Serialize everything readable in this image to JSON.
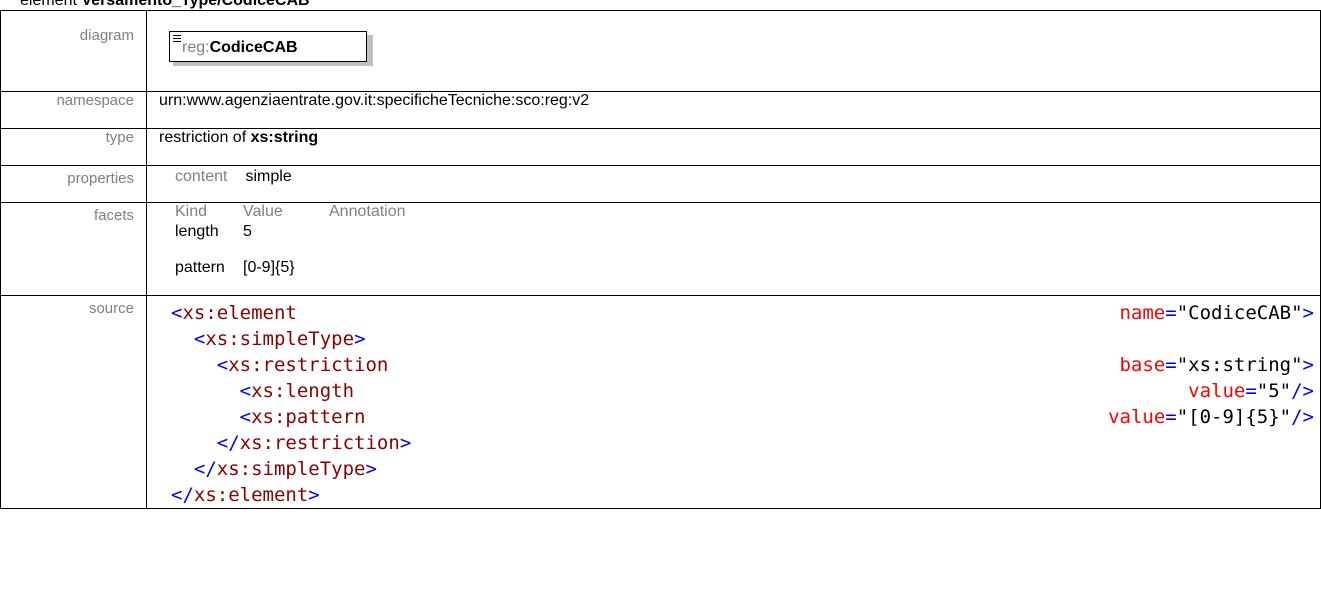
{
  "heading": {
    "prefix": "element ",
    "title": "Versamento_Type/CodiceCAB"
  },
  "rows": {
    "diagram": {
      "label": "diagram",
      "element_prefix": "reg:",
      "element_local": "CodiceCAB"
    },
    "namespace": {
      "label": "namespace",
      "value": "urn:www.agenziaentrate.gov.it:specificheTecniche:sco:reg:v2"
    },
    "type": {
      "label": "type",
      "prefix": "restriction of ",
      "base": "xs:string"
    },
    "properties": {
      "label": "properties",
      "key": "content",
      "value": "simple"
    },
    "facets": {
      "label": "facets",
      "headers": [
        "Kind",
        "Value",
        "Annotation"
      ],
      "items": [
        {
          "kind": "length",
          "value": "5"
        },
        {
          "kind": "pattern",
          "value": "[0-9]{5}"
        }
      ]
    },
    "source": {
      "label": "source",
      "lines": [
        {
          "indent": "",
          "open": "<",
          "tag": "xs:element",
          "attr_name": "name",
          "eq": "=",
          "attr_value": "\"CodiceCAB\"",
          "close": ">"
        },
        {
          "indent": "  ",
          "open": "<",
          "tag": "xs:simpleType",
          "close": ">"
        },
        {
          "indent": "    ",
          "open": "<",
          "tag": "xs:restriction",
          "attr_name": "base",
          "eq": "=",
          "attr_value": "\"xs:string\"",
          "close": ">"
        },
        {
          "indent": "      ",
          "open": "<",
          "tag": "xs:length",
          "attr_name": "value",
          "eq": "=",
          "attr_value": "\"5\"",
          "close": "/>"
        },
        {
          "indent": "      ",
          "open": "<",
          "tag": "xs:pattern",
          "attr_name": "value",
          "eq": "=",
          "attr_value": "\"[0-9]{5}\"",
          "close": "/>"
        },
        {
          "indent": "    ",
          "open": "</",
          "tag": "xs:restriction",
          "close": ">"
        },
        {
          "indent": "  ",
          "open": "</",
          "tag": "xs:simpleType",
          "close": ">"
        },
        {
          "indent": "",
          "open": "</",
          "tag": "xs:element",
          "close": ">"
        }
      ]
    }
  }
}
